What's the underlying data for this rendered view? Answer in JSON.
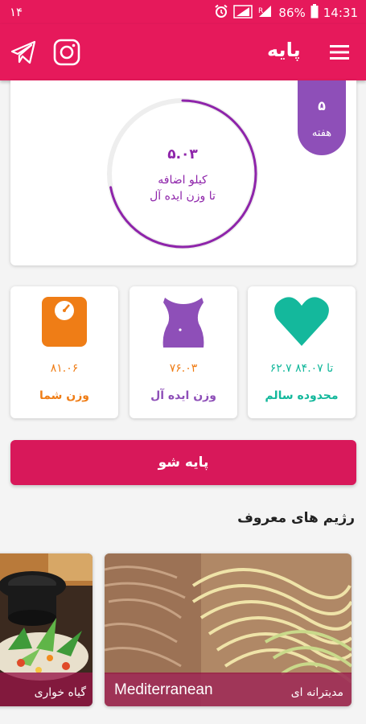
{
  "status_bar": {
    "notification": "۱۴",
    "battery": "86%",
    "time": "14:31"
  },
  "app_bar": {
    "title": "پایه"
  },
  "progress": {
    "value": "۵.۰۳",
    "line1": "کیلو اضافه",
    "line2": "تا وزن ایده آل",
    "fraction": 0.72,
    "week_number": "۵",
    "week_label": "هفته"
  },
  "stats": {
    "weight": {
      "value": "۸۱.۰۶",
      "label": "وزن شما"
    },
    "ideal": {
      "value": "۷۶.۰۳",
      "label": "وزن ایده آل"
    },
    "healthy": {
      "value": "۶۲.۷ تا ۸۴.۰۷",
      "label": "محدوده سالم"
    }
  },
  "main_button": {
    "label": "پایه شو"
  },
  "diets_section": {
    "title": "رژیم های معروف"
  },
  "diets": [
    {
      "latin": "",
      "persian": "گیاه خواری"
    },
    {
      "latin": "Mediterranean",
      "persian": "مدیترانه ای"
    }
  ],
  "colors": {
    "primary": "#e6195b",
    "purple": "#8e24aa",
    "orange": "#ef7d16",
    "teal": "#14b89c"
  }
}
